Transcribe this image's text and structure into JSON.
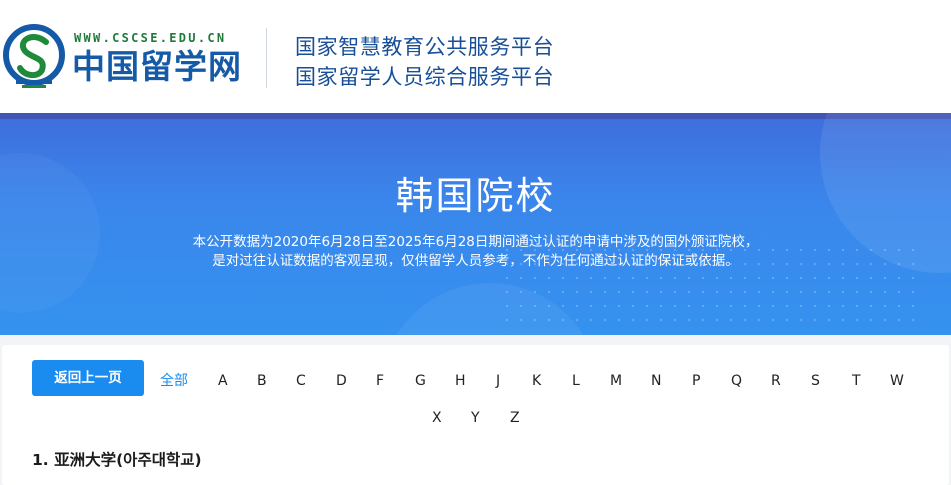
{
  "header": {
    "logo_icon": "cscse-emblem-icon",
    "site_url": "WWW.CSCSE.EDU.CN",
    "site_name": "中国留学网",
    "platform_line1": "国家智慧教育公共服务平台",
    "platform_line2": "国家留学人员综合服务平台"
  },
  "banner": {
    "title": "韩国院校",
    "desc_line1": "本公开数据为2020年6月28日至2025年6月28日期间通过认证的申请中涉及的国外颁证院校，",
    "desc_line2": "是对过往认证数据的客观呈现，仅供留学人员参考，不作为任何通过认证的保证或依据。"
  },
  "nav": {
    "back_label": "返回上一页",
    "all_label": "全部",
    "letters": [
      "A",
      "B",
      "C",
      "D",
      "F",
      "G",
      "H",
      "J",
      "K",
      "L",
      "M",
      "N",
      "P",
      "Q",
      "R",
      "S",
      "T",
      "W",
      "X",
      "Y",
      "Z"
    ]
  },
  "list": {
    "items": [
      {
        "number": "1.",
        "name": "亚洲大学(아주대학교)"
      }
    ]
  },
  "colors": {
    "accent": "#1a8cf0",
    "banner": "#3a86ec",
    "brand_blue": "#155aa6",
    "brand_green": "#1f7a3a"
  }
}
